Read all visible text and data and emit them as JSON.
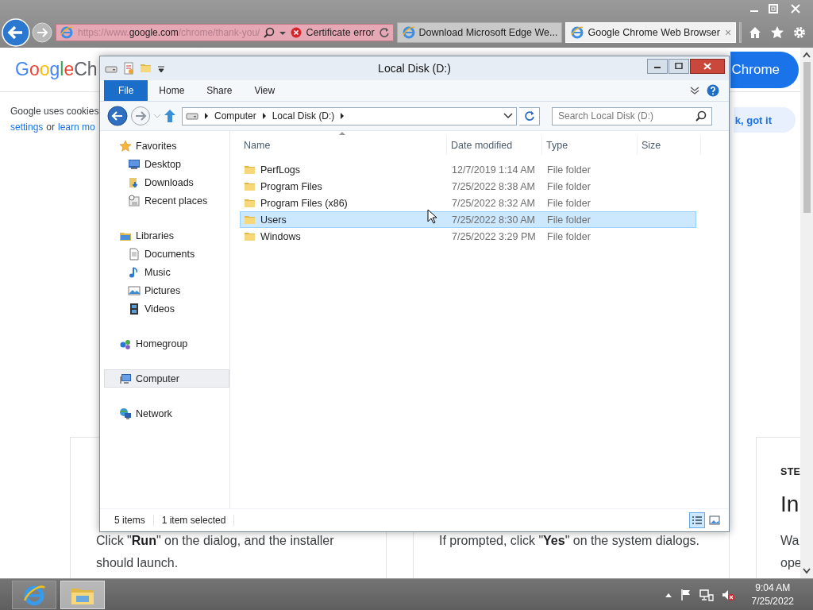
{
  "browser": {
    "address": {
      "url": "https://www.**google.com**/chrome/thank-you/",
      "security": "Certificate error"
    },
    "tabs": [
      {
        "label": "Download Microsoft Edge We...",
        "selected": false
      },
      {
        "label": "Google Chrome Web Browser",
        "selected": true,
        "close": "×"
      }
    ]
  },
  "page": {
    "logo": {
      "brand": "Google",
      "rest": "Ch"
    },
    "cta": "Chrome",
    "cookie": {
      "text": "Google uses cookies",
      "line2": [
        {
          "kind": "link",
          "text": "settings"
        },
        {
          "kind": "text",
          "text": "or"
        },
        {
          "kind": "link",
          "text": "learn mo"
        }
      ],
      "button": "k, got it"
    },
    "cards": [
      {
        "body": [
          "Click \"**Run**\" on the dialog, and the installer should launch."
        ]
      },
      {
        "body": [
          "If prompted, click \"**Yes**\" on the system dialogs."
        ]
      },
      {
        "step": "STE",
        "title": "In",
        "body": [
          "Wa",
          "ope"
        ]
      }
    ]
  },
  "explorer": {
    "title": "Local Disk (D:)",
    "ribbon_tabs": [
      {
        "label": "File",
        "kind": "file"
      },
      {
        "label": "Home",
        "kind": "tab"
      },
      {
        "label": "Share",
        "kind": "tab"
      },
      {
        "label": "View",
        "kind": "tab"
      }
    ],
    "breadcrumb": [
      "Computer",
      "Local Disk (D:)"
    ],
    "search": {
      "placeholder": "Search Local Disk (D:)"
    },
    "nav": [
      {
        "label": "Favorites",
        "selected": false,
        "children": [
          {
            "label": "Desktop",
            "selected": false
          },
          {
            "label": "Downloads",
            "selected": false
          },
          {
            "label": "Recent places",
            "selected": false
          }
        ]
      },
      {
        "label": "Libraries",
        "selected": false,
        "children": [
          {
            "label": "Documents",
            "selected": false
          },
          {
            "label": "Music",
            "selected": false
          },
          {
            "label": "Pictures",
            "selected": false
          },
          {
            "label": "Videos",
            "selected": false
          }
        ]
      },
      {
        "label": "Homegroup",
        "selected": false
      },
      {
        "label": "Computer",
        "selected": true
      },
      {
        "label": "Network",
        "selected": false
      }
    ],
    "columns": [
      "Name",
      "Date modified",
      "Type",
      "Size"
    ],
    "rows": [
      {
        "name": "PerfLogs",
        "date": "12/7/2019 1:14 AM",
        "type": "File folder",
        "selected": false
      },
      {
        "name": "Program Files",
        "date": "7/25/2022 8:38 AM",
        "type": "File folder",
        "selected": false
      },
      {
        "name": "Program Files (x86)",
        "date": "7/25/2022 8:32 AM",
        "type": "File folder",
        "selected": false
      },
      {
        "name": "Users",
        "date": "7/25/2022 8:30 AM",
        "type": "File folder",
        "selected": true
      },
      {
        "name": "Windows",
        "date": "7/25/2022 3:29 PM",
        "type": "File folder",
        "selected": false
      }
    ],
    "status": {
      "count": "5 items",
      "selection": "1 item selected"
    }
  },
  "taskbar": {
    "time": "9:04 AM",
    "date": "7/25/2022"
  }
}
